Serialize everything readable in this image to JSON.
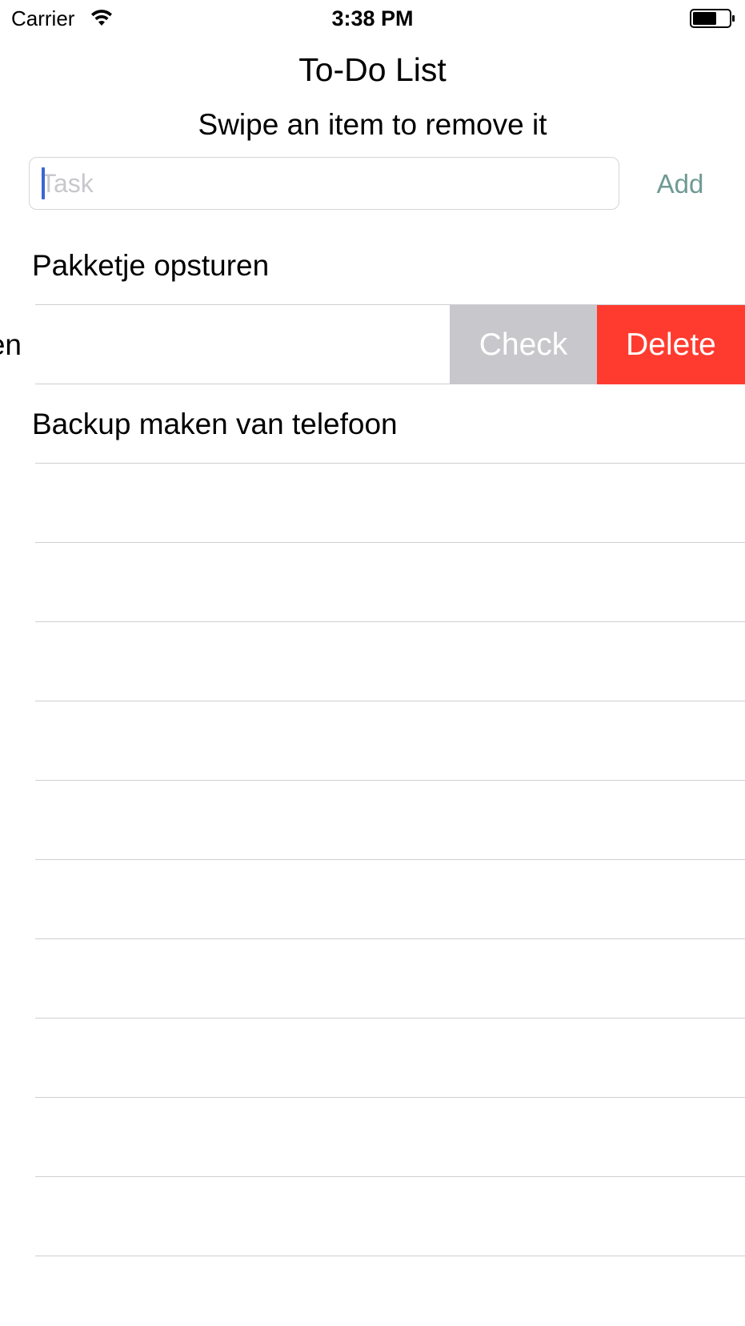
{
  "status_bar": {
    "carrier": "Carrier",
    "time": "3:38 PM",
    "wifi_icon": "wifi-icon",
    "battery_icon": "battery-icon"
  },
  "header": {
    "title": "To-Do List",
    "subtitle": "Swipe an item to remove it"
  },
  "task_input": {
    "value": "",
    "placeholder": "Task"
  },
  "add_button": {
    "label": "Add",
    "color": "#6f9a94"
  },
  "tasks": [
    {
      "label": "Pakketje opsturen"
    },
    {
      "label": "Boodschappen doen",
      "swiped": true
    },
    {
      "label": "Backup maken van telefoon"
    }
  ],
  "swipe_actions": {
    "check_label": "Check",
    "check_color": "#c8c7cc",
    "delete_label": "Delete",
    "delete_color": "#ff3b30"
  }
}
